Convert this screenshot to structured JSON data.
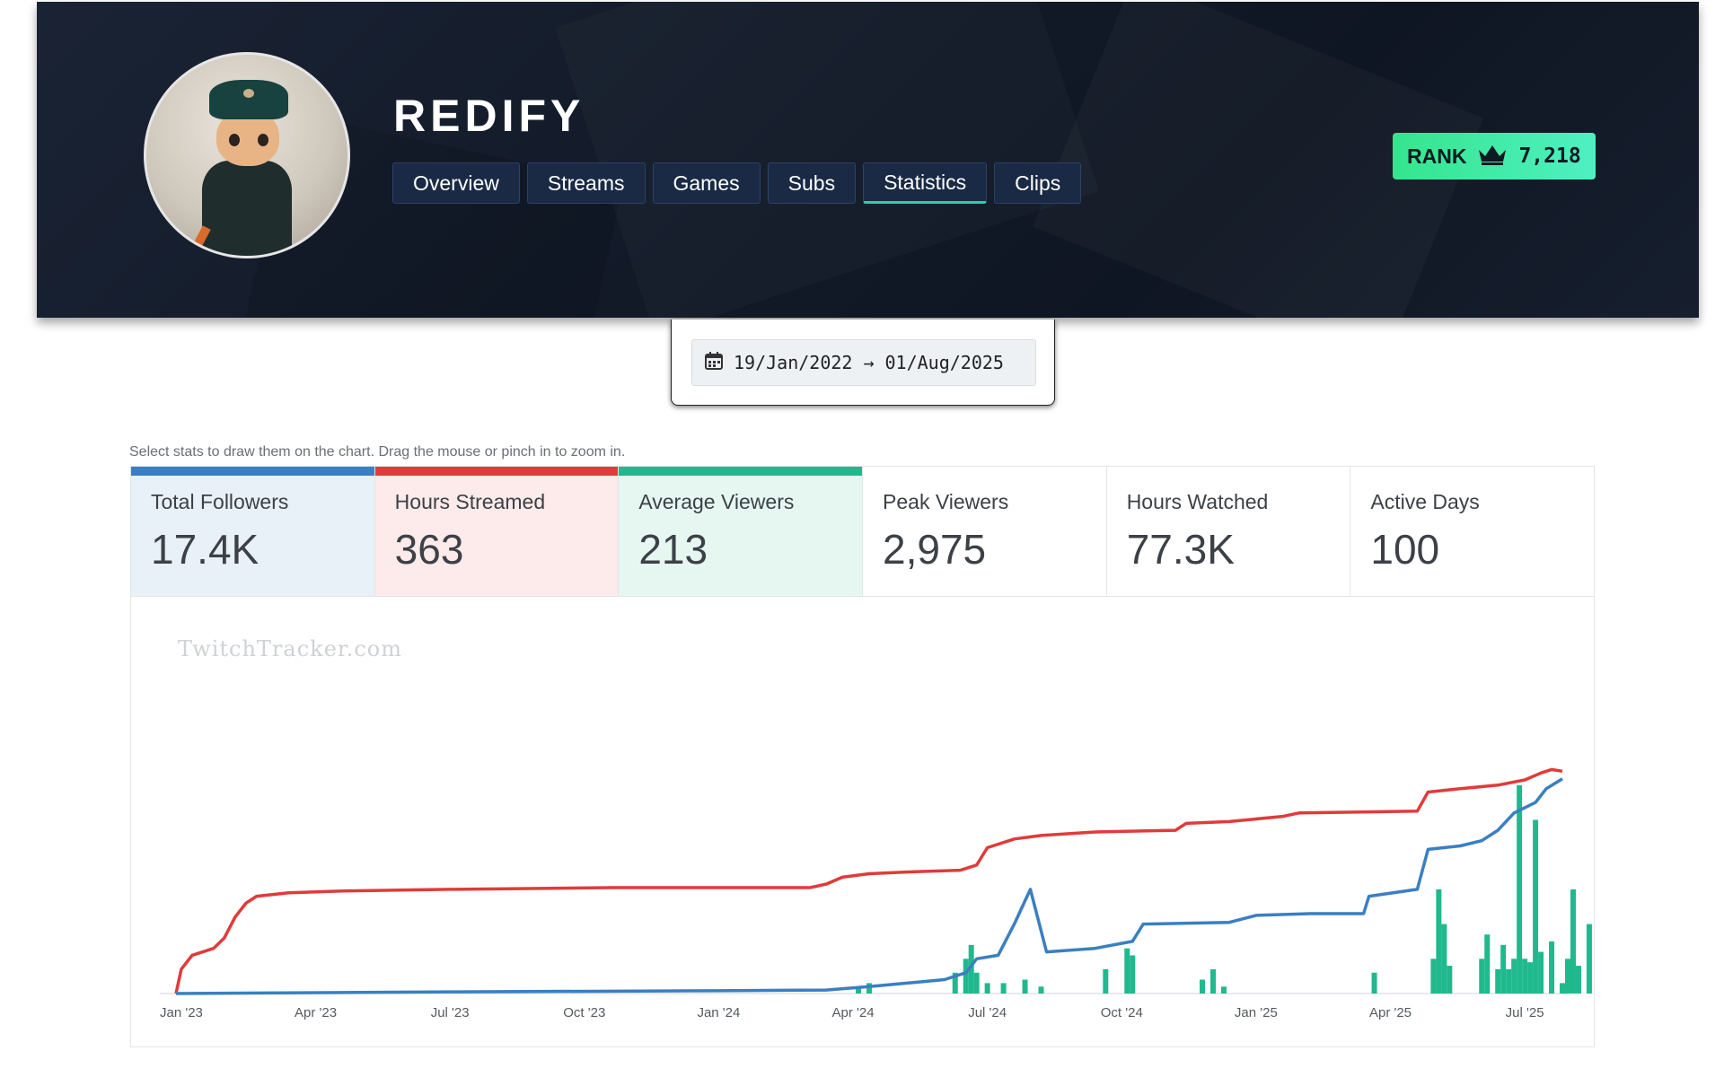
{
  "header": {
    "channel_name": "REDIFY",
    "avatar_alt": "cat-avatar"
  },
  "nav": {
    "tabs": [
      {
        "label": "Overview",
        "active": false
      },
      {
        "label": "Streams",
        "active": false
      },
      {
        "label": "Games",
        "active": false
      },
      {
        "label": "Subs",
        "active": false
      },
      {
        "label": "Statistics",
        "active": true
      },
      {
        "label": "Clips",
        "active": false
      }
    ]
  },
  "rank": {
    "label": "RANK",
    "icon": "crown-icon",
    "value": "7,218"
  },
  "date_range": {
    "icon": "calendar-icon",
    "start": "19/Jan/2022",
    "arrow": "→",
    "end": "01/Aug/2025"
  },
  "hint": "Select stats to draw them on the chart. Drag the mouse or pinch in to zoom in.",
  "stats": [
    {
      "label": "Total Followers",
      "value": "17.4K",
      "selected": true,
      "color": "#3a7fc1",
      "bg": "#e9f1f8"
    },
    {
      "label": "Hours Streamed",
      "value": "363",
      "selected": true,
      "color": "#e03b3b",
      "bg": "#fdeaea"
    },
    {
      "label": "Average Viewers",
      "value": "213",
      "selected": true,
      "color": "#20b98e",
      "bg": "#e6f7f1"
    },
    {
      "label": "Peak Viewers",
      "value": "2,975",
      "selected": false,
      "color": "",
      "bg": "#ffffff"
    },
    {
      "label": "Hours Watched",
      "value": "77.3K",
      "selected": false,
      "color": "",
      "bg": "#ffffff"
    },
    {
      "label": "Active Days",
      "value": "100",
      "selected": false,
      "color": "",
      "bg": "#ffffff"
    }
  ],
  "chart_data": {
    "type": "line",
    "watermark": "TwitchTracker.com",
    "x_ticks": [
      "Jan '23",
      "Apr '23",
      "Jul '23",
      "Oct '23",
      "Jan '24",
      "Apr '24",
      "Jul '24",
      "Oct '24",
      "Jan '25",
      "Apr '25",
      "Jul '25"
    ],
    "x_start": 2022.96,
    "x_end": 2025.58,
    "grid": false,
    "legend": "none",
    "series": [
      {
        "key": "hours_streamed",
        "type": "line",
        "color": "#e03b3b",
        "ymax": 1.0,
        "points": [
          [
            2022.99,
            0.0
          ],
          [
            2023.0,
            0.07
          ],
          [
            2023.02,
            0.11
          ],
          [
            2023.06,
            0.13
          ],
          [
            2023.08,
            0.16
          ],
          [
            2023.1,
            0.22
          ],
          [
            2023.12,
            0.26
          ],
          [
            2023.14,
            0.28
          ],
          [
            2023.2,
            0.29
          ],
          [
            2023.3,
            0.295
          ],
          [
            2023.5,
            0.3
          ],
          [
            2023.8,
            0.305
          ],
          [
            2024.0,
            0.305
          ],
          [
            2024.17,
            0.305
          ],
          [
            2024.2,
            0.315
          ],
          [
            2024.23,
            0.335
          ],
          [
            2024.28,
            0.345
          ],
          [
            2024.35,
            0.35
          ],
          [
            2024.45,
            0.355
          ],
          [
            2024.48,
            0.37
          ],
          [
            2024.5,
            0.42
          ],
          [
            2024.55,
            0.445
          ],
          [
            2024.6,
            0.455
          ],
          [
            2024.7,
            0.465
          ],
          [
            2024.85,
            0.47
          ],
          [
            2024.87,
            0.49
          ],
          [
            2024.95,
            0.495
          ],
          [
            2025.05,
            0.51
          ],
          [
            2025.08,
            0.52
          ],
          [
            2025.3,
            0.525
          ],
          [
            2025.32,
            0.58
          ],
          [
            2025.38,
            0.59
          ],
          [
            2025.45,
            0.6
          ],
          [
            2025.5,
            0.615
          ],
          [
            2025.53,
            0.635
          ],
          [
            2025.55,
            0.645
          ],
          [
            2025.57,
            0.64
          ]
        ]
      },
      {
        "key": "total_followers",
        "type": "line",
        "color": "#3a7fc1",
        "ymax": 1.0,
        "points": [
          [
            2022.99,
            0.0
          ],
          [
            2023.5,
            0.005
          ],
          [
            2024.0,
            0.008
          ],
          [
            2024.2,
            0.01
          ],
          [
            2024.28,
            0.02
          ],
          [
            2024.35,
            0.03
          ],
          [
            2024.42,
            0.04
          ],
          [
            2024.46,
            0.06
          ],
          [
            2024.48,
            0.1
          ],
          [
            2024.52,
            0.11
          ],
          [
            2024.55,
            0.2
          ],
          [
            2024.58,
            0.3
          ],
          [
            2024.61,
            0.12
          ],
          [
            2024.7,
            0.13
          ],
          [
            2024.77,
            0.15
          ],
          [
            2024.79,
            0.2
          ],
          [
            2024.95,
            0.205
          ],
          [
            2025.0,
            0.225
          ],
          [
            2025.1,
            0.23
          ],
          [
            2025.2,
            0.23
          ],
          [
            2025.21,
            0.28
          ],
          [
            2025.3,
            0.3
          ],
          [
            2025.32,
            0.415
          ],
          [
            2025.38,
            0.425
          ],
          [
            2025.42,
            0.44
          ],
          [
            2025.45,
            0.47
          ],
          [
            2025.48,
            0.52
          ],
          [
            2025.52,
            0.55
          ],
          [
            2025.54,
            0.59
          ],
          [
            2025.57,
            0.618
          ]
        ]
      },
      {
        "key": "average_viewers",
        "type": "bar",
        "color": "#20b98e",
        "ymax": 1.0,
        "points": [
          [
            2024.26,
            0.02
          ],
          [
            2024.28,
            0.03
          ],
          [
            2024.44,
            0.06
          ],
          [
            2024.46,
            0.1
          ],
          [
            2024.47,
            0.14
          ],
          [
            2024.48,
            0.06
          ],
          [
            2024.5,
            0.03
          ],
          [
            2024.53,
            0.03
          ],
          [
            2024.57,
            0.04
          ],
          [
            2024.6,
            0.02
          ],
          [
            2024.72,
            0.07
          ],
          [
            2024.76,
            0.13
          ],
          [
            2024.77,
            0.11
          ],
          [
            2024.9,
            0.04
          ],
          [
            2024.92,
            0.07
          ],
          [
            2024.94,
            0.02
          ],
          [
            2025.22,
            0.06
          ],
          [
            2025.33,
            0.1
          ],
          [
            2025.34,
            0.3
          ],
          [
            2025.35,
            0.2
          ],
          [
            2025.36,
            0.08
          ],
          [
            2025.42,
            0.1
          ],
          [
            2025.43,
            0.17
          ],
          [
            2025.45,
            0.07
          ],
          [
            2025.46,
            0.14
          ],
          [
            2025.47,
            0.07
          ],
          [
            2025.48,
            0.1
          ],
          [
            2025.49,
            0.6
          ],
          [
            2025.5,
            0.1
          ],
          [
            2025.51,
            0.09
          ],
          [
            2025.52,
            0.5
          ],
          [
            2025.53,
            0.12
          ],
          [
            2025.55,
            0.15
          ],
          [
            2025.57,
            0.03
          ],
          [
            2025.58,
            0.1
          ],
          [
            2025.59,
            0.3
          ],
          [
            2025.6,
            0.08
          ],
          [
            2025.62,
            0.2
          ]
        ]
      }
    ]
  }
}
